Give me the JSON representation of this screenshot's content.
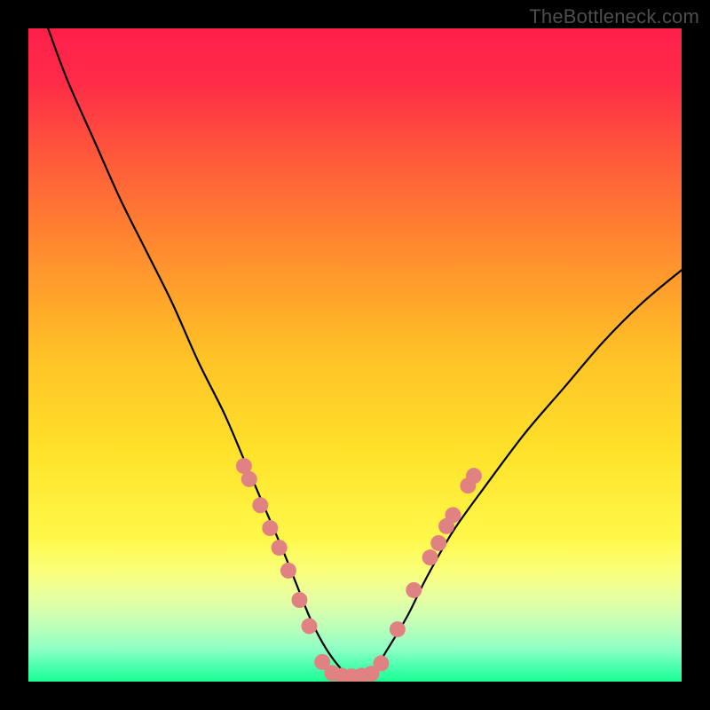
{
  "watermark": "TheBottleneck.com",
  "gradient": {
    "stops": [
      {
        "offset": 0.0,
        "color": "#ff1f4a"
      },
      {
        "offset": 0.08,
        "color": "#ff2b48"
      },
      {
        "offset": 0.2,
        "color": "#ff5a3a"
      },
      {
        "offset": 0.35,
        "color": "#ff8f2e"
      },
      {
        "offset": 0.5,
        "color": "#ffc227"
      },
      {
        "offset": 0.65,
        "color": "#ffe22a"
      },
      {
        "offset": 0.78,
        "color": "#fff84a"
      },
      {
        "offset": 0.83,
        "color": "#fbff7a"
      },
      {
        "offset": 0.87,
        "color": "#e8ffa0"
      },
      {
        "offset": 0.91,
        "color": "#c4ffb8"
      },
      {
        "offset": 0.95,
        "color": "#8effc4"
      },
      {
        "offset": 0.975,
        "color": "#4fffb0"
      },
      {
        "offset": 1.0,
        "color": "#19ff94"
      }
    ]
  },
  "chart_data": {
    "type": "line",
    "title": "",
    "xlabel": "",
    "ylabel": "",
    "xlim": [
      0,
      100
    ],
    "ylim": [
      0,
      100
    ],
    "series": [
      {
        "name": "bottleneck-curve",
        "x": [
          0,
          3,
          6,
          10,
          14,
          18,
          22,
          26,
          30,
          33,
          36,
          39,
          41,
          43,
          45,
          47,
          49,
          51,
          53,
          55,
          58,
          61,
          65,
          70,
          76,
          82,
          88,
          94,
          100
        ],
        "y": [
          108,
          100,
          92,
          83,
          74,
          66,
          58,
          49,
          41,
          34,
          27,
          20,
          15,
          10,
          6,
          3,
          1,
          1,
          2,
          5,
          10,
          16,
          23,
          30,
          38,
          45,
          52,
          58,
          63
        ]
      }
    ],
    "markers": {
      "name": "highlight-dots",
      "color": "#e18282",
      "points": [
        {
          "x": 33.0,
          "y": 33.0
        },
        {
          "x": 33.8,
          "y": 31.0
        },
        {
          "x": 35.5,
          "y": 27.0
        },
        {
          "x": 37.0,
          "y": 23.5
        },
        {
          "x": 38.4,
          "y": 20.5
        },
        {
          "x": 39.8,
          "y": 17.0
        },
        {
          "x": 41.5,
          "y": 12.5
        },
        {
          "x": 43.0,
          "y": 8.5
        },
        {
          "x": 45.0,
          "y": 3.0
        },
        {
          "x": 46.5,
          "y": 1.3
        },
        {
          "x": 48.0,
          "y": 0.9
        },
        {
          "x": 49.5,
          "y": 0.8
        },
        {
          "x": 51.0,
          "y": 0.9
        },
        {
          "x": 52.5,
          "y": 1.2
        },
        {
          "x": 54.0,
          "y": 2.8
        },
        {
          "x": 56.5,
          "y": 8.0
        },
        {
          "x": 59.0,
          "y": 14.0
        },
        {
          "x": 61.5,
          "y": 19.0
        },
        {
          "x": 62.8,
          "y": 21.2
        },
        {
          "x": 64.0,
          "y": 23.8
        },
        {
          "x": 65.0,
          "y": 25.5
        },
        {
          "x": 67.3,
          "y": 30.0
        },
        {
          "x": 68.2,
          "y": 31.5
        }
      ]
    }
  }
}
